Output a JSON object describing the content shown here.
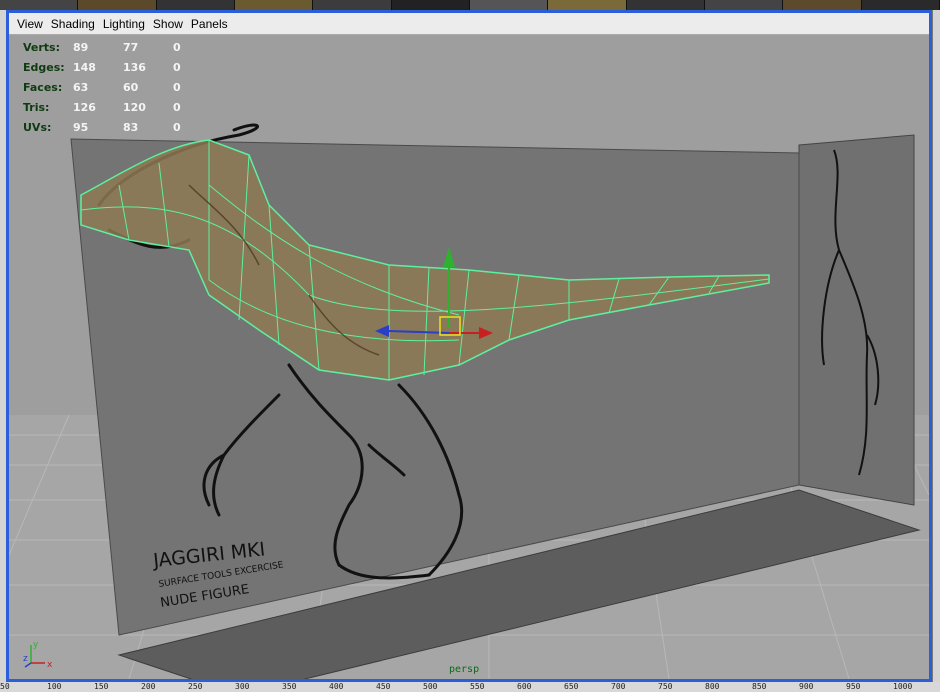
{
  "menu": {
    "view": "View",
    "shading": "Shading",
    "lighting": "Lighting",
    "show": "Show",
    "panels": "Panels"
  },
  "hud": {
    "rows": [
      {
        "label": "Verts:",
        "v1": "89",
        "v2": "77",
        "v3": "0"
      },
      {
        "label": "Edges:",
        "v1": "148",
        "v2": "136",
        "v3": "0"
      },
      {
        "label": "Faces:",
        "v1": "63",
        "v2": "60",
        "v3": "0"
      },
      {
        "label": "Tris:",
        "v1": "126",
        "v2": "120",
        "v3": "0"
      },
      {
        "label": "UVs:",
        "v1": "95",
        "v2": "83",
        "v3": "0"
      }
    ]
  },
  "sketch_text": {
    "title": "JAGGIRI MKI",
    "line2": "SURFACE TOOLS EXCERCISE",
    "line3": "NUDE FIGURE"
  },
  "camera_label": "persp",
  "axis": {
    "y": "y",
    "z": "z",
    "x": "x"
  },
  "ruler": [
    "50",
    "100",
    "150",
    "200",
    "250",
    "300",
    "350",
    "400",
    "450",
    "500",
    "550",
    "600",
    "650",
    "700",
    "750",
    "800",
    "850",
    "900",
    "950",
    "1000"
  ],
  "colors": {
    "frame": "#2b5fd9",
    "wire": "#5ef0a0",
    "mesh_fill": "#8d7a55",
    "hud_label": "#0f3b10"
  }
}
